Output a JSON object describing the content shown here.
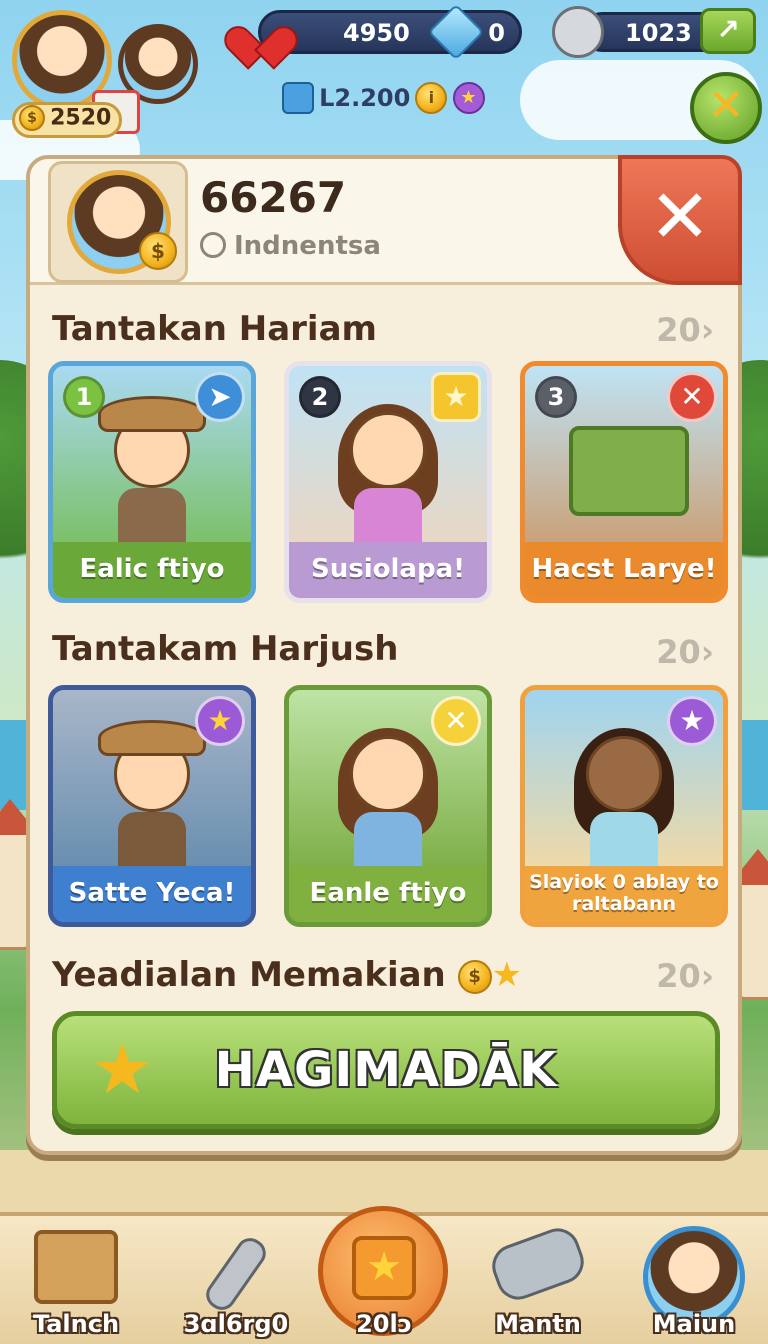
{
  "hud": {
    "player_coins": "2520",
    "hearts_value": "4950",
    "gems_value": "0",
    "tools_value": "1023",
    "level_text": "L2.200"
  },
  "profile": {
    "player_id": "66267",
    "country": "Indnentsa"
  },
  "sections": [
    {
      "title": "Tantakan Hariam",
      "count": "20",
      "cards": [
        {
          "number": "1",
          "label": "Ealic ftiyo",
          "color": "#5aa6d8",
          "label_bg": "#6aa83a"
        },
        {
          "number": "2",
          "label": "Susiolapa!",
          "color": "#e7e1ec",
          "label_bg": "#b99ad2"
        },
        {
          "number": "3",
          "label": "Hacst Larye!",
          "color": "#ef8a2e",
          "label_bg": "#ea8a2c"
        }
      ]
    },
    {
      "title": "Tantakam Harjush",
      "count": "20",
      "cards": [
        {
          "label": "Satte Yeca!",
          "color": "#3e5a9a",
          "label_bg": "#3f7fcf"
        },
        {
          "label": "Eanle ftiyo",
          "color": "#6a9a3a",
          "label_bg": "#7fb040"
        },
        {
          "label": "Slayiok 0 ablay to raltabann",
          "color": "#f0a03e",
          "label_bg": "#efa43e"
        }
      ]
    }
  ],
  "rewards": {
    "title": "Yeadialan Memakian",
    "count": "20"
  },
  "main_button": {
    "label": "HAGIMADĀK"
  },
  "bottom_nav": [
    {
      "label": "Talnch"
    },
    {
      "label": "3ɑl6rg0"
    },
    {
      "label": "20lɔ"
    },
    {
      "label": "Mantn"
    },
    {
      "label": "Maiun"
    }
  ],
  "colors": {
    "panel_bg": "#f7efdc",
    "close_red": "#d9563a",
    "button_green": "#8fc24a"
  },
  "icons": {
    "close": "✕",
    "arrow": "›",
    "star": "★",
    "up_arrow": "↗"
  }
}
